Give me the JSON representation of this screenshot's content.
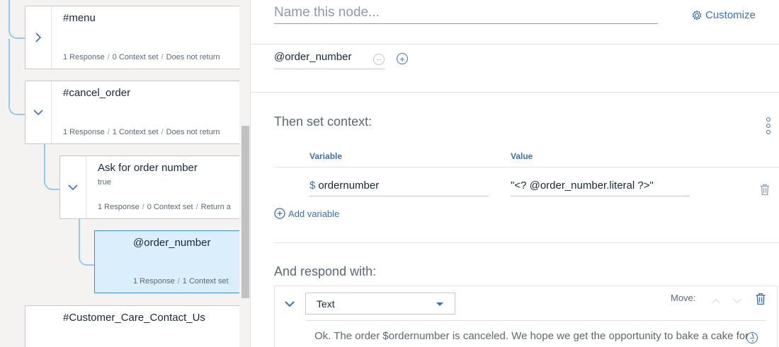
{
  "tree": {
    "nodes": [
      {
        "title": "#menu",
        "condition": "",
        "responses": "1 Response",
        "context": "0 Context set",
        "returns": "Does not return"
      },
      {
        "title": "#cancel_order",
        "condition": "",
        "responses": "1 Response",
        "context": "1 Context set",
        "returns": "Does not return"
      },
      {
        "title": "Ask for order number",
        "condition": "true",
        "responses": "1 Response",
        "context": "0 Context set",
        "returns": "Return a"
      },
      {
        "title": "@order_number",
        "condition": "",
        "responses": "1 Response",
        "context": "1 Context set",
        "returns": ""
      },
      {
        "title": "#Customer_Care_Contact_Us",
        "condition": "",
        "responses": "",
        "context": "",
        "returns": ""
      }
    ]
  },
  "editor": {
    "name_placeholder": "Name this node...",
    "customize_label": "Customize",
    "condition_value": "@order_number",
    "context_section": {
      "title": "Then set context:",
      "variable_header": "Variable",
      "value_header": "Value",
      "rows": [
        {
          "dollar": "$",
          "variable": "ordernumber",
          "value": "\"<? @order_number.literal ?>\""
        }
      ],
      "add_variable_label": "Add variable"
    },
    "respond_section": {
      "title": "And respond with:",
      "type_selected": "Text",
      "move_label": "Move:",
      "response_text": "Ok. The order $ordernumber is canceled. We hope we get the opportunity to bake a cake for you sometime soon."
    }
  },
  "colors": {
    "accent": "#3d70b2",
    "tree_line": "#8fcdf0",
    "selected_bg": "#dbeefb",
    "selected_border": "#3d8fd1"
  }
}
